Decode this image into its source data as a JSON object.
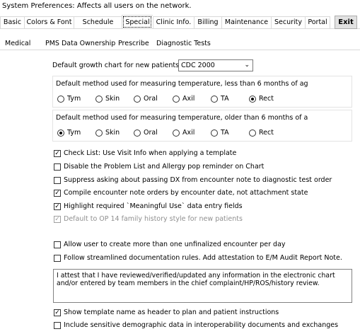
{
  "window": {
    "title": "System Preferences: Affects all users on the network."
  },
  "top_tabs": [
    {
      "label": "Basic"
    },
    {
      "label": "Colors & Font"
    },
    {
      "label": "Schedule"
    },
    {
      "label": "Special"
    },
    {
      "label": "Clinic Info."
    },
    {
      "label": "Billing"
    },
    {
      "label": "Maintenance"
    },
    {
      "label": "Security"
    },
    {
      "label": "Portal"
    }
  ],
  "active_top_tab": "Special",
  "exit_label": "Exit",
  "sub_tabs": [
    {
      "label": "Medical"
    },
    {
      "label": "PMS Data Ownership"
    },
    {
      "label": "Prescribe"
    },
    {
      "label": "Diagnostic Tests"
    }
  ],
  "growth_chart": {
    "label": "Default growth chart for new patients:",
    "value": "CDC 2000"
  },
  "temp_under6": {
    "label": "Default method used for measuring temperature, less than 6 months of ag",
    "options": [
      "Tym",
      "Skin",
      "Oral",
      "Axil",
      "TA",
      "Rect"
    ],
    "selected": "Rect"
  },
  "temp_over6": {
    "label": "Default method used for measuring temperature, older than 6 months of a",
    "options": [
      "Tym",
      "Skin",
      "Oral",
      "Axil",
      "TA",
      "Rect"
    ],
    "selected": "Tym"
  },
  "checkboxes": [
    {
      "label": "Check List: Use Visit Info when applying a template",
      "checked": true,
      "disabled": false
    },
    {
      "label": "Disable the Problem List and Allergy pop reminder on Chart",
      "checked": false,
      "disabled": false
    },
    {
      "label": "Suppress asking about passing DX from encounter note to diagnostic test order",
      "checked": false,
      "disabled": false
    },
    {
      "label": "Compile encounter note orders by encounter date, not attachment state",
      "checked": true,
      "disabled": false
    },
    {
      "label": "Highlight required `Meaningful Use` data entry fields",
      "checked": true,
      "disabled": false
    },
    {
      "label": "Default to OP 14 family history style for new patients",
      "checked": true,
      "disabled": true
    },
    {
      "label": "Allow user to create more than one unfinalized encounter per day",
      "checked": false,
      "disabled": false
    },
    {
      "label": "Follow streamlined documentation rules.  Add attestation to E/M Audit Report Note.",
      "checked": false,
      "disabled": false
    },
    {
      "label": "Show template name as header to plan and patient instructions",
      "checked": true,
      "disabled": false
    },
    {
      "label": "Include sensitive demographic data in interoperability documents and exchanges",
      "checked": false,
      "disabled": false
    }
  ],
  "attestation_text": "I attest that I have reviewed/verified/updated any information in the electronic chart and/or entered by team members in the chief complaint/HP/ROS/history review."
}
